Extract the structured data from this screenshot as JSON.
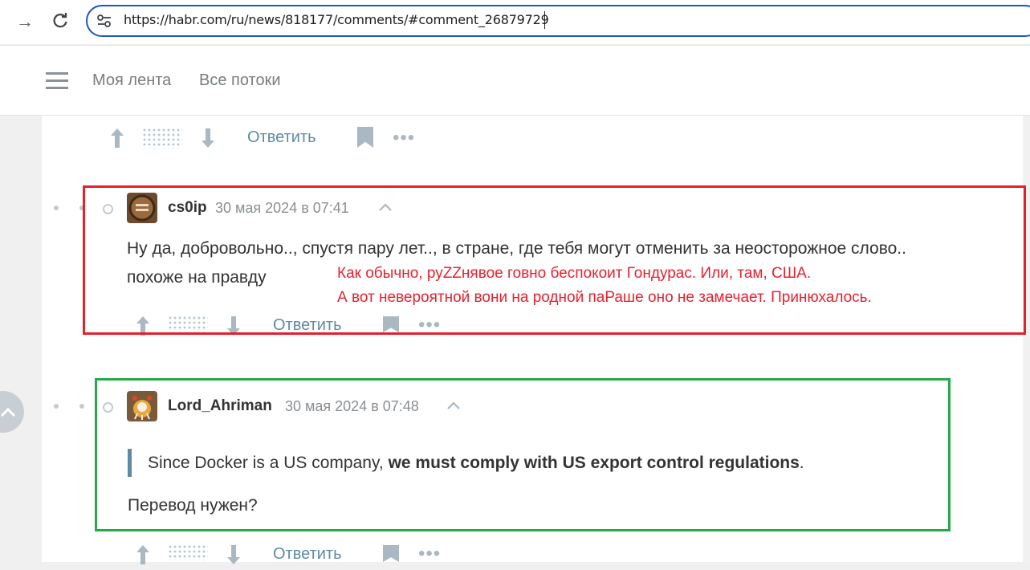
{
  "browser": {
    "url": "https://habr.com/ru/news/818177/comments/#comment_26879729",
    "forward_icon": "→",
    "reload_icon": "↻"
  },
  "header": {
    "nav": [
      "Моя лента",
      "Все потоки"
    ]
  },
  "actions": {
    "reply_label": "Ответить",
    "upvote_icon": "arrow-up",
    "downvote_icon": "arrow-down",
    "more_icon": "•••"
  },
  "comments": [
    {
      "username": "cs0ip",
      "date": "30 мая 2024 в 07:41",
      "lines": [
        "Ну да, добровольно.., спустя пару лет.., в стране, где тебя могут отменить за неосторожное слово..",
        "похоже на правду"
      ]
    },
    {
      "username": "Lord_Ahriman",
      "date": "30 мая 2024 в 07:48",
      "quote_normal": "Since Docker is a US company, ",
      "quote_bold": "we must comply with US export control regulations",
      "quote_end": ".",
      "text": "Перевод нужен?"
    }
  ],
  "annotation": {
    "line1": "Как обычно, руZZнявое говно беспокоит Гондурас. Или, там, США.",
    "line2": "А  вот невероятной вони на родной паРаше оно не замечает. Принюхалось.",
    "color": "#e6222f"
  },
  "colors": {
    "accent": "#5e8aa6",
    "red_box": "#e3202d",
    "green_box": "#27a94a",
    "url_border": "#1a56c4"
  }
}
